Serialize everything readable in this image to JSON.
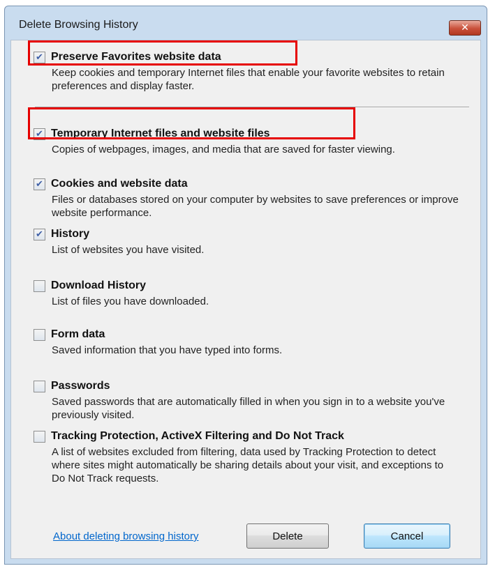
{
  "window": {
    "title": "Delete Browsing History",
    "close_glyph": "✕"
  },
  "options": [
    {
      "label": "Preserve Favorites website data",
      "description": "Keep cookies and temporary Internet files that enable your favorite websites to retain preferences and display faster.",
      "checked": true
    },
    {
      "label": "Temporary Internet files and website files",
      "description": "Copies of webpages, images, and media that are saved for faster viewing.",
      "checked": true
    },
    {
      "label": "Cookies and website data",
      "description": "Files or databases stored on your computer by websites to save preferences or improve website performance.",
      "checked": true
    },
    {
      "label": "History",
      "description": "List of websites you have visited.",
      "checked": true
    },
    {
      "label": "Download History",
      "description": "List of files you have downloaded.",
      "checked": false
    },
    {
      "label": "Form data",
      "description": "Saved information that you have typed into forms.",
      "checked": false
    },
    {
      "label": "Passwords",
      "description": "Saved passwords that are automatically filled in when you sign in to a website you've previously visited.",
      "checked": false
    },
    {
      "label": "Tracking Protection, ActiveX Filtering and Do Not Track",
      "description": "A list of websites excluded from filtering, data used by Tracking Protection to detect where sites might automatically be sharing details about your visit, and exceptions to Do Not Track requests.",
      "checked": false
    }
  ],
  "footer": {
    "help_link": "About deleting browsing history",
    "delete_button": "Delete",
    "cancel_button": "Cancel"
  },
  "colors": {
    "highlight": "#e60000",
    "link": "#0066cc",
    "checkmark": "#3d5ea6"
  }
}
